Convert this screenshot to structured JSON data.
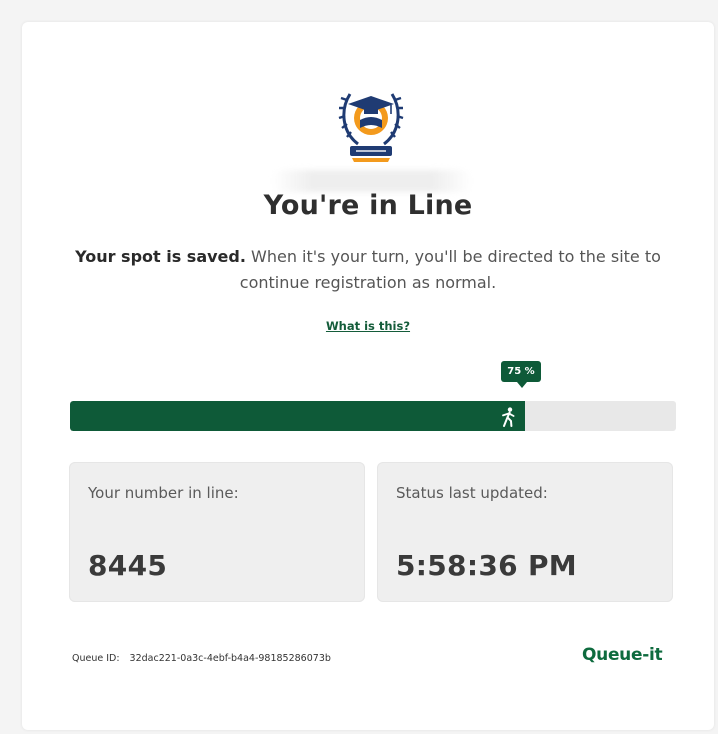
{
  "header": {
    "title": "You're in Line"
  },
  "message": {
    "strong": "Your spot is saved.",
    "text": " When it's your turn, you'll be directed to the site to continue registration as normal."
  },
  "help": {
    "link_label": "What is this?"
  },
  "progress": {
    "percent_label": "75 %",
    "fraction": 0.75
  },
  "stats": {
    "number_label": "Your number in line:",
    "number_value": "8445",
    "updated_label": "Status last updated:",
    "updated_value": "5:58:36 PM"
  },
  "footer": {
    "queue_id_label": "Queue ID:",
    "queue_id_value": "32dac221-0a3c-4ebf-b4a4-98185286073b",
    "brand": "Queue-it"
  },
  "colors": {
    "accent": "#0e5a38",
    "brand": "#0e6b3e",
    "logo_navy": "#1f3b73",
    "logo_orange": "#f39a1d"
  },
  "icons": {
    "logo": "school-graduation-cap-logo",
    "walker": "walking-person-icon"
  }
}
